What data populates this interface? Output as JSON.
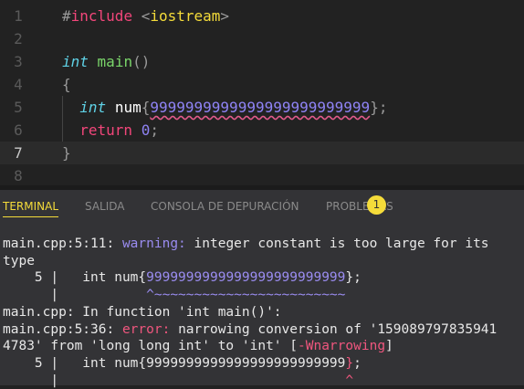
{
  "editor": {
    "line_numbers": [
      "1",
      "2",
      "3",
      "4",
      "5",
      "6",
      "7",
      "8"
    ],
    "include_hash": "#",
    "include_kw": "include",
    "include_open": "<",
    "include_file": "iostream",
    "include_close": ">",
    "int_kw": "int",
    "main_fn": "main",
    "parens": "()",
    "open_brace": "{",
    "num_var": "num",
    "brace_l": "{",
    "big_number": "9999999999999999999999999",
    "brace_r": "}",
    "semi": ";",
    "return_kw": "return",
    "zero": "0",
    "close_brace": "}"
  },
  "panel": {
    "tabs": [
      {
        "label": "TERMINAL"
      },
      {
        "label": "SALIDA"
      },
      {
        "label": "CONSOLA DE DEPURACIÓN"
      },
      {
        "label": "PROBLEMAS"
      }
    ],
    "problems_count": "1",
    "accent": "#f5dc3a"
  },
  "terminal": {
    "l1_pre": "main.cpp:5:11: ",
    "l1_warn": "warning:",
    "l1_post": " integer constant is too large for its",
    "l2": "type",
    "l3_pre": "    5 |   int num{",
    "l3_num": "9999999999999999999999999",
    "l3_post": "};",
    "l4_pre": "      |           ",
    "l4_mark": "^~~~~~~~~~~~~~~~~~~~~~~~~",
    "l5": "main.cpp: In function 'int main()':",
    "l6_pre": "main.cpp:5:36: ",
    "l6_err": "error:",
    "l6_post": " narrowing conversion of '159089797835941",
    "l7_pre": "4783' from 'long long int' to 'int' [",
    "l7_flag": "-Wnarrowing",
    "l7_post": "]",
    "l8_pre": "    5 |   int num{9999999999999999999999999",
    "l8_brace": "}",
    "l8_post": ";",
    "l9_pre": "      |                                    ",
    "l9_mark": "^"
  }
}
